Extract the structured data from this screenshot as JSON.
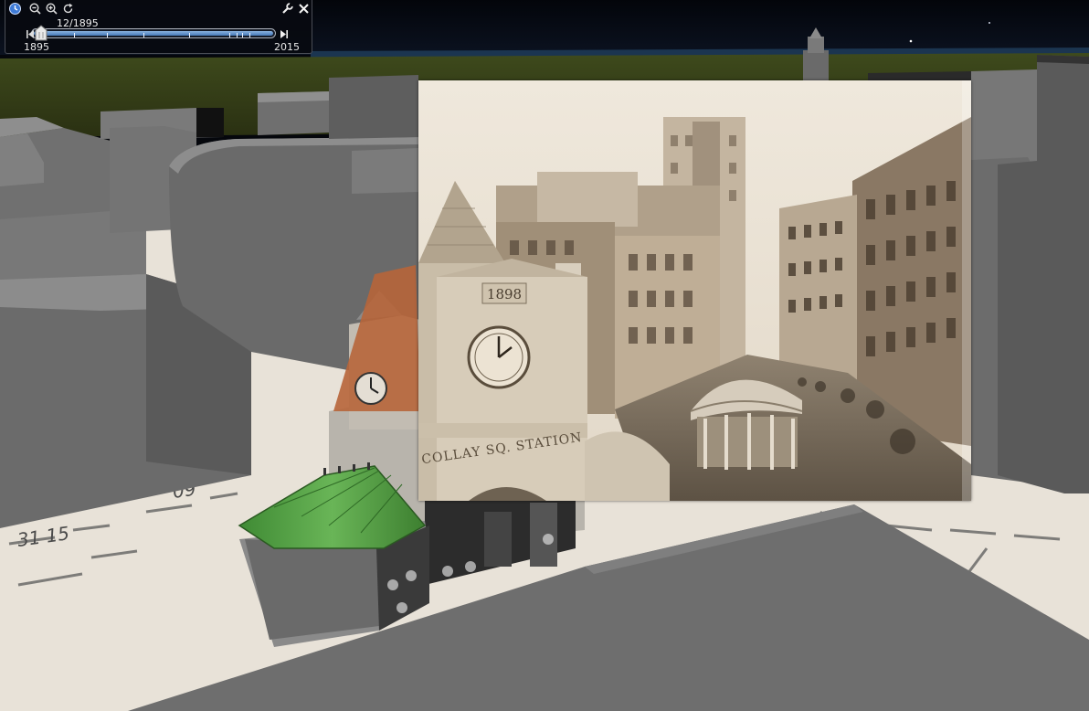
{
  "slider": {
    "date": "12/1895",
    "start_year": "1895",
    "end_year": "2015",
    "position_fraction": 0.0
  },
  "toolbar": {
    "clock_icon": "clock-icon",
    "zoom_out_icon": "zoom-out-icon",
    "zoom_in_icon": "zoom-in-icon",
    "refresh_icon": "refresh-icon",
    "settings_icon": "wrench-icon",
    "close_icon": "close-icon",
    "play_icon": "play-end-icon"
  },
  "overlay": {
    "clock_year": "1898",
    "station_sign": "COLLAY SQ. STATION"
  },
  "colors": {
    "sky": "#05070c",
    "building": "#6e6e6e",
    "kiosk_roof": "#4e9a3c",
    "slider_fill": "#4679b8",
    "photo_sepia": "#c9bba2"
  }
}
